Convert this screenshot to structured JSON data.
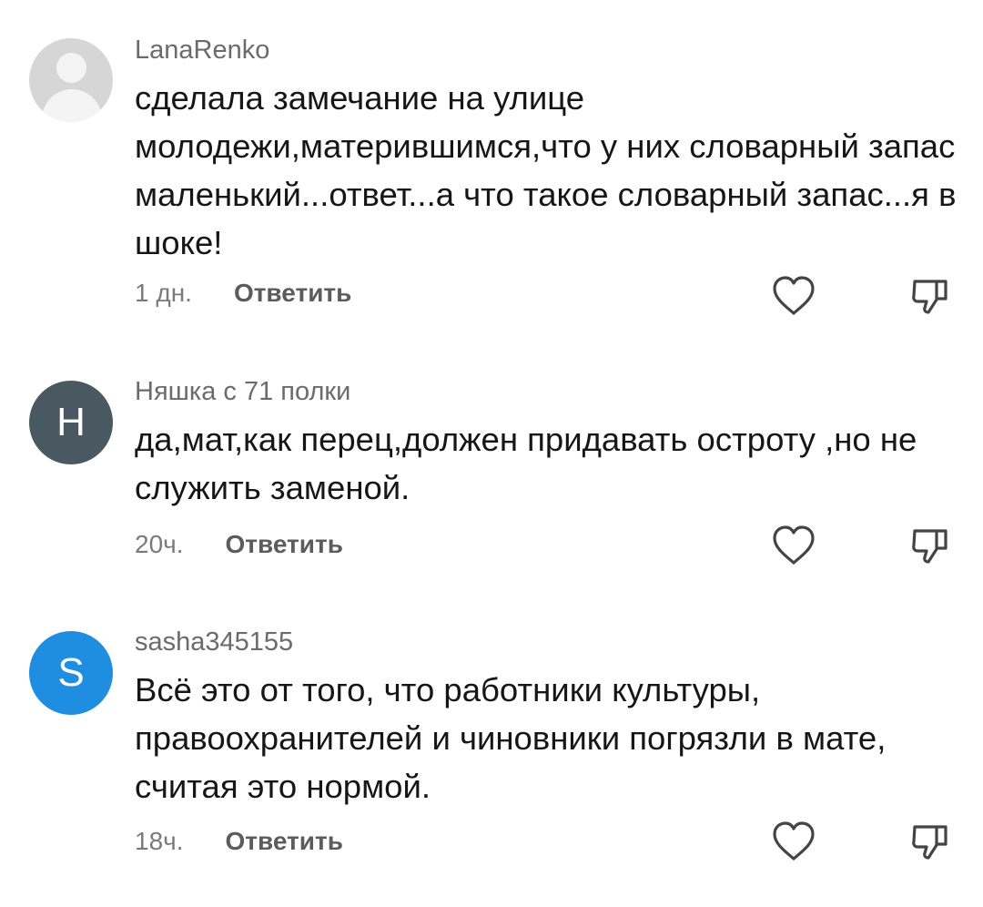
{
  "comments": [
    {
      "author": "LanaRenko",
      "avatar_letter": "",
      "avatar_color": "#d6d6d6",
      "text": "сделала замечание на улице молодежи,матерившимся,что у них словарный запас маленький...ответ...а что такое словарный запас...я в шоке!",
      "time": "1 дн.",
      "reply_label": "Ответить"
    },
    {
      "author": "Няшка с 71 полки",
      "avatar_letter": "H",
      "avatar_color": "#4a5961",
      "text": "да,мат,как перец,должен придавать остроту ,но не служить заменой.",
      "time": "20ч.",
      "reply_label": "Ответить"
    },
    {
      "author": "sasha345155",
      "avatar_letter": "S",
      "avatar_color": "#1f8ee0",
      "text": "Всё это от того, что работники культуры, правоохранителей и чиновники погрязли в мате, считая это нормой.",
      "time": "18ч.",
      "reply_label": "Ответить"
    }
  ],
  "icons": {
    "like": "heart-outline-icon",
    "dislike": "thumbs-down-outline-icon"
  }
}
